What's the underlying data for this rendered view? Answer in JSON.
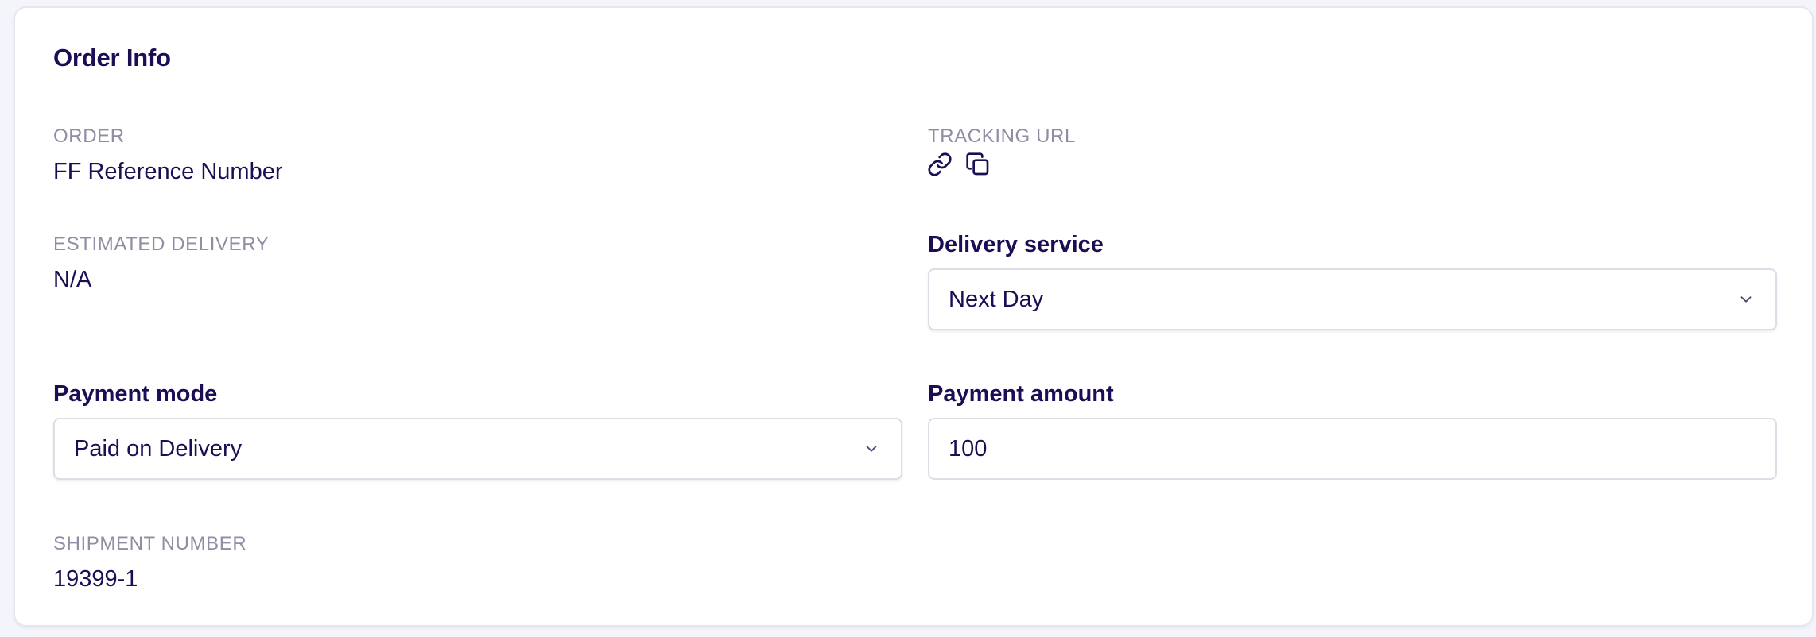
{
  "card": {
    "title": "Order Info"
  },
  "order": {
    "label": "ORDER",
    "value": "FF Reference Number"
  },
  "tracking": {
    "label": "TRACKING URL",
    "icons": [
      "link-icon",
      "copy-icon"
    ]
  },
  "estimated_delivery": {
    "label": "ESTIMATED DELIVERY",
    "value": "N/A"
  },
  "delivery_service": {
    "label": "Delivery service",
    "selected": "Next Day"
  },
  "payment_mode": {
    "label": "Payment mode",
    "selected": "Paid on Delivery"
  },
  "payment_amount": {
    "label": "Payment amount",
    "value": "100"
  },
  "shipment": {
    "label": "SHIPMENT NUMBER",
    "value": "19399-1"
  },
  "colors": {
    "text_primary": "#1c0d55",
    "text_muted": "#8f8ea3",
    "border": "#dcdde5",
    "page_bg": "#f4f5fb"
  }
}
